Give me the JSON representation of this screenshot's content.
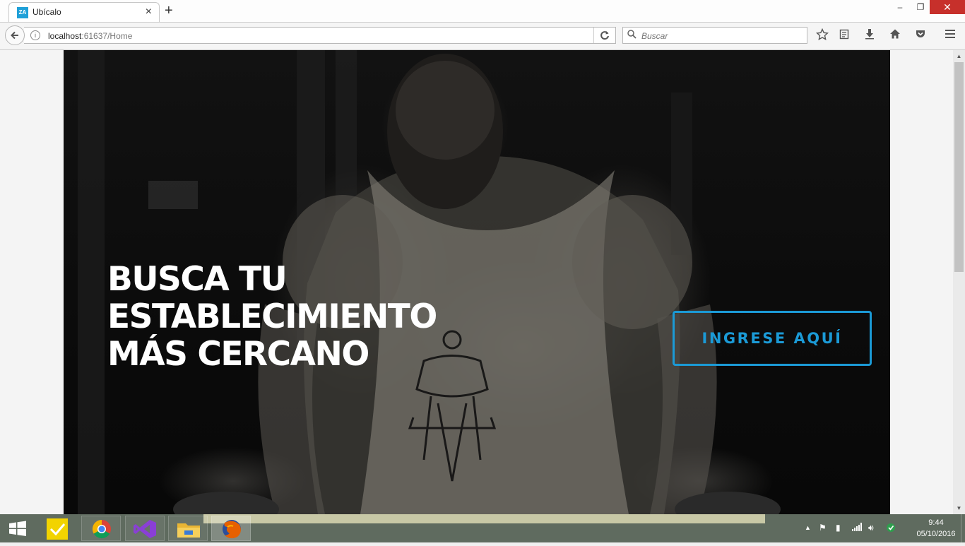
{
  "browser": {
    "tab": {
      "favicon": "ZA",
      "title": "Ubícalo",
      "close_icon": "×"
    },
    "new_tab_icon": "+",
    "window_controls": {
      "minimize": "–",
      "maximize": "❐",
      "close": "✕"
    },
    "nav": {
      "back_icon": "back-arrow",
      "info_icon": "i",
      "url_host": "localhost",
      "url_rest": ":61637/Home",
      "reload_icon": "reload"
    },
    "search": {
      "placeholder": "Buscar",
      "icon": "magnifier"
    },
    "toolbar_icons": [
      "bookmark-star",
      "reading-list",
      "download",
      "home",
      "pocket",
      "menu"
    ]
  },
  "page": {
    "headline": [
      "BUSCA TU",
      "ESTABLECIMIENTO",
      "MÁS CERCANO"
    ],
    "cta_label": "INGRESE AQUÍ",
    "accent_color": "#1b9ad6"
  },
  "taskbar": {
    "apps": [
      "sticky-notes",
      "chrome",
      "visual-studio",
      "file-explorer",
      "firefox"
    ],
    "clock_time": "9:44",
    "clock_date": "05/10/2016"
  }
}
